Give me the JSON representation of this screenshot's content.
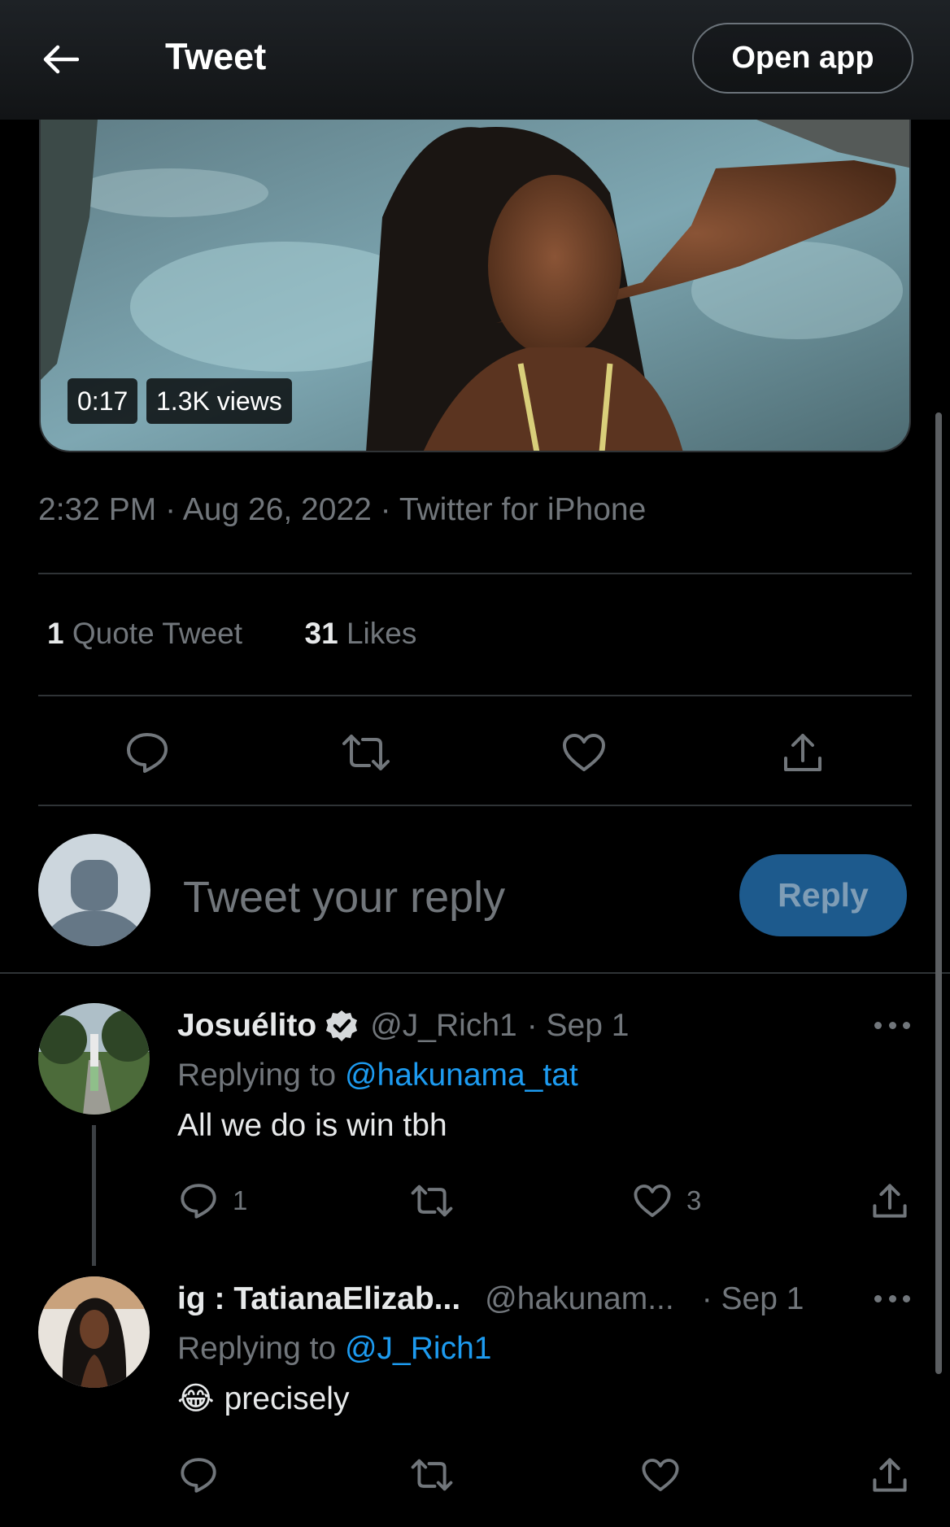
{
  "header": {
    "title": "Tweet",
    "open_app": "Open app"
  },
  "video": {
    "duration": "0:17",
    "views": "1.3K views"
  },
  "tweet_meta": {
    "time": "2:32 PM",
    "date": "Aug 26, 2022",
    "source": "Twitter for iPhone",
    "separator": "·"
  },
  "stats": {
    "quote_count": "1",
    "quote_label": "Quote Tweet",
    "like_count": "31",
    "like_label": "Likes"
  },
  "composer": {
    "placeholder": "Tweet your reply",
    "reply_button": "Reply"
  },
  "replies": [
    {
      "name": "Josuélito",
      "verified": true,
      "handle": "@J_Rich1",
      "date": "· Sep 1",
      "replying_prefix": "Replying to",
      "replying_to": "@hakunama_tat",
      "text": "All we do is win tbh",
      "reply_count": "1",
      "like_count": "3"
    },
    {
      "name": "ig : TatianaElizab...",
      "verified": false,
      "handle": "@hakunam...",
      "date": "· Sep 1",
      "replying_prefix": "Replying to",
      "replying_to": "@J_Rich1",
      "emoji": "😂",
      "text": "precisely",
      "reply_count": "",
      "like_count": ""
    }
  ],
  "colors": {
    "accent": "#1d9bf0",
    "reply_button": "#1d5a8d",
    "muted": "#71767b",
    "divider": "#2f3336"
  },
  "icons": [
    "back-arrow-icon",
    "reply-icon",
    "retweet-icon",
    "like-icon",
    "share-icon",
    "verified-badge-icon",
    "more-icon",
    "laughing-emoji"
  ]
}
